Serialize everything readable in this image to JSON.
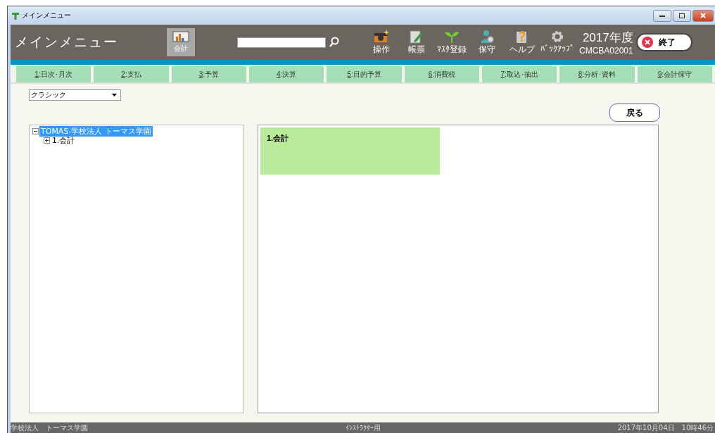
{
  "window": {
    "title": "メインメニュー"
  },
  "header": {
    "title": "メインメニュー",
    "module_button": {
      "label": "会計",
      "selected": true
    },
    "tools": [
      {
        "kind": "camera",
        "label": "操作"
      },
      {
        "kind": "note",
        "label": "帳票"
      },
      {
        "kind": "sprout",
        "label": "ﾏｽﾀ登録"
      },
      {
        "kind": "person",
        "label": "保守"
      },
      {
        "kind": "help",
        "label": "ヘルプ"
      },
      {
        "kind": "gear",
        "label": "ﾊﾞｯｸｱｯﾌﾟ"
      }
    ],
    "fiscal_year": "2017年度",
    "screen_code": "CMCBA02001",
    "exit_button": "終了"
  },
  "tabs": [
    {
      "key": "1",
      "label": ":日次･月次"
    },
    {
      "key": "2",
      "label": ":支払"
    },
    {
      "key": "3",
      "label": ":予算"
    },
    {
      "key": "4",
      "label": ":決算"
    },
    {
      "key": "5",
      "label": ":目的予算"
    },
    {
      "key": "6",
      "label": ":消費税"
    },
    {
      "key": "7",
      "label": ":取込･抽出"
    },
    {
      "key": "8",
      "label": ":分析･資料"
    },
    {
      "key": "9",
      "label": ":会計保守"
    }
  ],
  "view_select": {
    "value": "クラシック"
  },
  "back_button": "戻る",
  "tree": [
    {
      "label": "TOMAS-学校法人 トーマス学園",
      "selected": true,
      "expanded": true,
      "children": [
        {
          "label": "1.会計",
          "selected": false,
          "expanded": false
        }
      ]
    }
  ],
  "tiles": [
    {
      "label": "1.会計"
    }
  ],
  "status_bar": {
    "left": "学校法人　トーマス学園",
    "center": "ｲﾝｽﾄﾗｸﾀｰ用",
    "right": "2017年10月04日　10時46分"
  }
}
